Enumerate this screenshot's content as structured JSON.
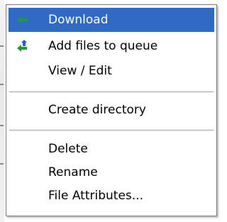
{
  "context_menu": {
    "items": [
      {
        "label": "Download",
        "icon": "download-arrow-icon",
        "selected": true
      },
      {
        "label": "Add files to queue",
        "icon": "add-to-queue-icon",
        "selected": false
      },
      {
        "label": "View / Edit",
        "icon": "",
        "selected": false
      },
      {
        "label": "Create directory",
        "icon": "",
        "selected": false
      },
      {
        "label": "Delete",
        "icon": "",
        "selected": false
      },
      {
        "label": "Rename",
        "icon": "",
        "selected": false
      },
      {
        "label": "File Attributes...",
        "icon": "",
        "selected": false
      }
    ]
  },
  "colors": {
    "selection": "#316ac5",
    "icon_green": "#1f9a3a",
    "icon_blue": "#2d5bd4"
  }
}
